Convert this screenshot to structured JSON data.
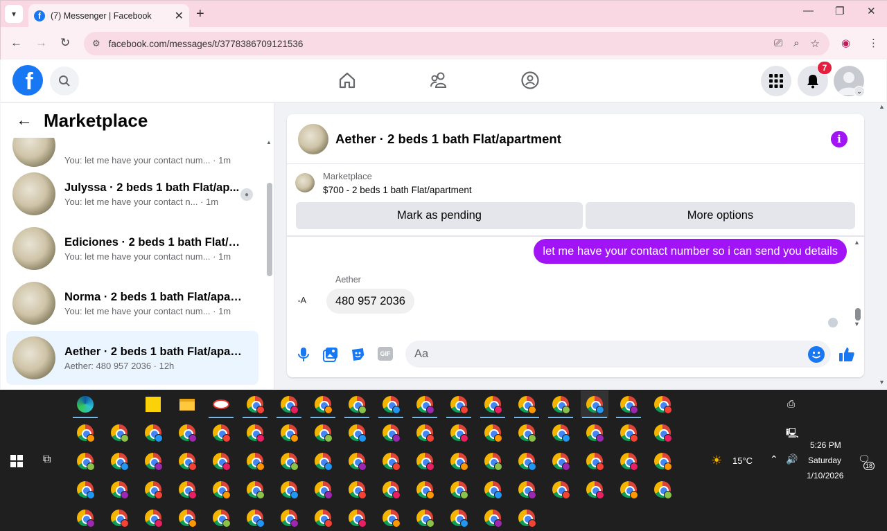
{
  "browser": {
    "tab_title": "(7) Messenger | Facebook",
    "url": "facebook.com/messages/t/3778386709121536"
  },
  "header": {
    "notification_count": "7"
  },
  "sidebar": {
    "title": "Marketplace",
    "conversations": [
      {
        "name": "",
        "subtitle": "You: let me have your contact num... · 1m"
      },
      {
        "name": "Julyssa · 2 beds 1 bath Flat/ap...",
        "subtitle": "You: let me have your contact n... · 1m"
      },
      {
        "name": "Ediciones · 2 beds 1 bath Flat/ap...",
        "subtitle": "You: let me have your contact num... · 1m"
      },
      {
        "name": "Norma · 2 beds 1 bath Flat/apart...",
        "subtitle": "You: let me have your contact num... · 1m"
      },
      {
        "name": "Aether · 2 beds 1 bath Flat/apart...",
        "subtitle": "Aether: 480 957 2036 · 12h"
      }
    ]
  },
  "chat": {
    "title": "Aether · 2 beds 1 bath Flat/apartment",
    "listing_category": "Marketplace",
    "listing_desc": "$700 - 2 beds 1 bath Flat/apartment",
    "btn_pending": "Mark as pending",
    "btn_more": "More options",
    "outgoing_message": "let me have your contact number so i can send you details",
    "sender_name": "Aether",
    "sender_avatar_alt": "A",
    "incoming_message": "480 957 2036",
    "composer_placeholder": "Aa"
  },
  "taskbar": {
    "temperature": "15°C",
    "time": "5:26 PM",
    "day": "Saturday",
    "date": "1/10/2026",
    "notification_count": "18"
  },
  "colors": {
    "fb_blue": "#1877f2",
    "messenger_purple": "#a014f5",
    "chrome_pink": "#fce4ec",
    "taskbar": "#1f1f1f"
  }
}
